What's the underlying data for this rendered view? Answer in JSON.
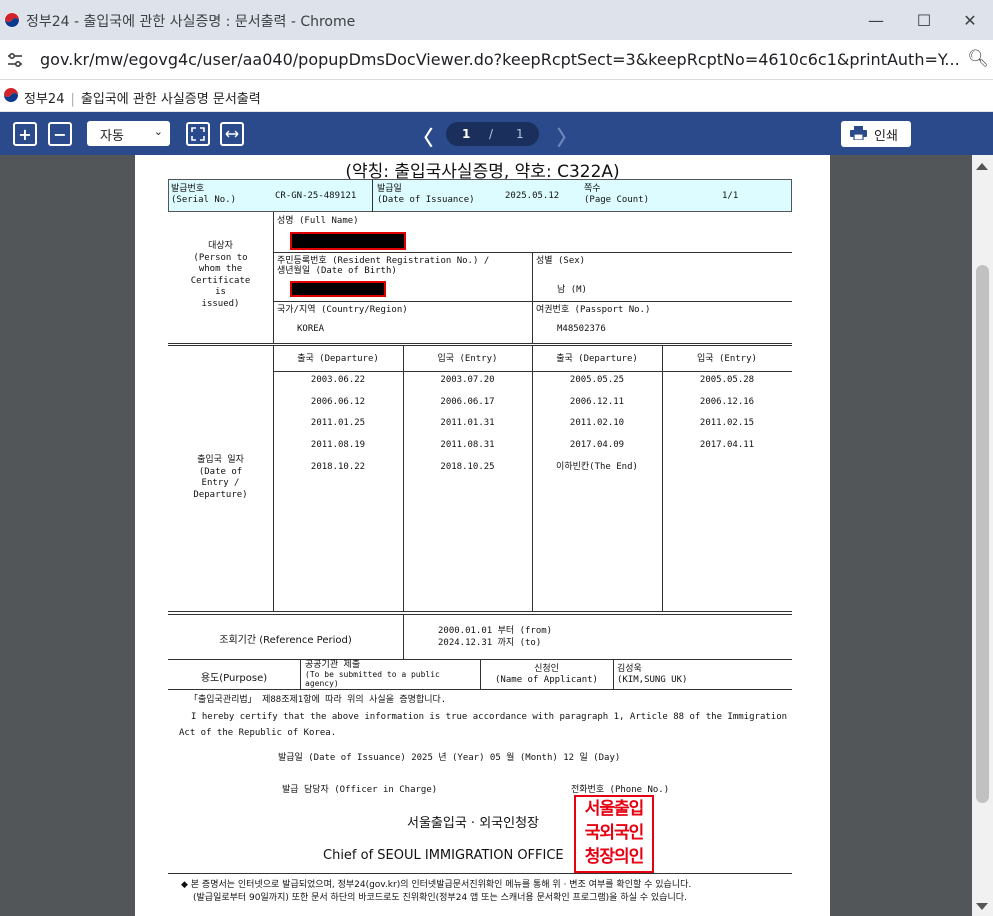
{
  "window": {
    "title": "정부24 - 출입국에 관한 사실증명 : 문서출력 - Chrome",
    "url": "gov.kr/mw/egovg4c/user/aa040/popupDmsDocViewer.do?keepRcptSect=3&keepRcptNo=4610c6c1&printAuth=Y...",
    "minimize": "—",
    "maximize": "☐",
    "close": "✕"
  },
  "header": {
    "brand": "정부24",
    "separator": "|",
    "page_title": "출입국에 관한 사실증명 문서출력"
  },
  "toolbar": {
    "zoom_in": "+",
    "zoom_out": "−",
    "zoom_mode": "자동",
    "prev": "〈",
    "next": "〉",
    "page_current": "1",
    "page_sep": "/",
    "page_total": "1",
    "print_label": "인쇄"
  },
  "doc": {
    "abbr_title": "(약칭: 출입국사실증명, 약호: C322A)",
    "serial_label": "발급번호",
    "serial_label_en": "(Serial No.)",
    "serial_value": "CR-GN-25-489121",
    "issue_label": "발급일",
    "issue_label_en": "(Date of Issuance)",
    "issue_value": "2025.05.12",
    "pages_label": "쪽수",
    "pages_label_en": "(Page Count)",
    "pages_value": "1/1",
    "subject_label": [
      "대상자",
      "(Person to",
      "whom the",
      "Certificate",
      "is",
      "issued)"
    ],
    "name_label": "성명 (Full Name)",
    "rrn_label": "주민등록번호 (Resident Registration No.) /",
    "dob_label": "생년월일 (Date of Birth)",
    "sex_label": "성별 (Sex)",
    "sex_value": "남 (M)",
    "country_label": "국가/지역 (Country/Region)",
    "country_value": "KOREA",
    "passport_label": "여권번호 (Passport No.)",
    "passport_value": "M48502376",
    "dates_label": [
      "출입국 일자",
      "(Date of",
      "Entry /",
      "Departure)"
    ],
    "col_headers": [
      "출국 (Departure)",
      "입국 (Entry)",
      "출국 (Departure)",
      "입국 (Entry)"
    ],
    "rows": [
      [
        "2003.06.22",
        "2003.07.20",
        "2005.05.25",
        "2005.05.28"
      ],
      [
        "2006.06.12",
        "2006.06.17",
        "2006.12.11",
        "2006.12.16"
      ],
      [
        "2011.01.25",
        "2011.01.31",
        "2011.02.10",
        "2011.02.15"
      ],
      [
        "2011.08.19",
        "2011.08.31",
        "2017.04.09",
        "2017.04.11"
      ],
      [
        "2018.10.22",
        "2018.10.25",
        "이하빈칸(The End)",
        ""
      ]
    ],
    "period_label": "조회기간 (Reference Period)",
    "period_from": "2000.01.01 부터 (from)",
    "period_to": "2024.12.31 까지 (to)",
    "purpose_label": "용도(Purpose)",
    "purpose_value_1": "공공기관 제출",
    "purpose_value_2": "(To be submitted to a public",
    "purpose_value_3": "agency)",
    "applicant_label": "신청인",
    "applicant_label_en": "(Name of Applicant)",
    "applicant_value": "김성욱",
    "applicant_value_en": "(KIM,SUNG UK)",
    "cert_ko": "「출입국관리법」 제88조제1항에 따라 위의 사실을 증명합니다.",
    "cert_en_1": "I hereby certify that the above information is true accordance with paragraph 1, Article 88 of the Immigration",
    "cert_en_2": "Act of the Republic of Korea.",
    "issuance_line": "발급일 (Date of Issuance)      2025  년 (Year)   05 월 (Month)   12 일 (Day)",
    "officer_label": "발급 담당자 (Officer in Charge)",
    "phone_label": "전화번호 (Phone No.)",
    "office_ko": "서울출입국 · 외국인청장",
    "office_en": "Chief of SEOUL IMMIGRATION OFFICE",
    "stamp_lines": [
      "서울출입",
      "국외국인",
      "청장의인"
    ],
    "note_1": "◆ 본 증명서는 인터넷으로 발급되었으며, 정부24(gov.kr)의 인터넷발급문서진위확인 메뉴를 통해 위 · 변조 여부를 확인할 수 있습니다.",
    "note_2": "(발급일로부터 90일까지) 또한 문서 하단의 바코드로도 진위확인(정부24 앱 또는 스캐너용 문서확인 프로그램)을 하실 수 있습니다."
  },
  "colors": {
    "toolbar_bg": "#2b4a8b",
    "viewer_bg": "#525659",
    "cyan_row": "#ddfcff",
    "redaction_border": "#e00000",
    "stamp_red": "#e60012"
  }
}
